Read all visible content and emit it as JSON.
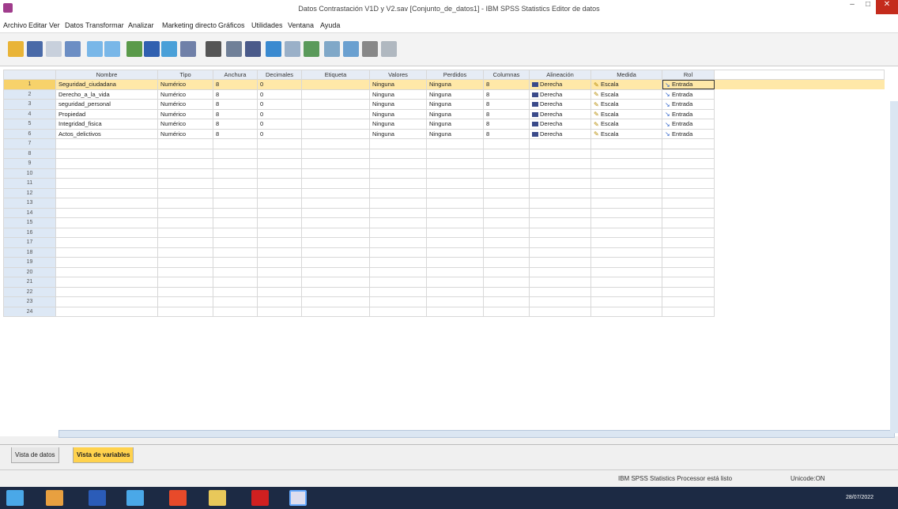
{
  "window": {
    "title": "Datos Contrastación V1D y V2.sav [Conjunto_de_datos1] - IBM SPSS Statistics Editor de datos"
  },
  "menu": [
    "Archivo",
    "Editar",
    "Ver",
    "Datos",
    "Transformar",
    "Analizar",
    "Marketing directo",
    "Gráficos",
    "Utilidades",
    "Ventana",
    "Ayuda"
  ],
  "columns": [
    "Nombre",
    "Tipo",
    "Anchura",
    "Decimales",
    "Etiqueta",
    "Valores",
    "Perdidos",
    "Columnas",
    "Alineación",
    "Medida",
    "Rol"
  ],
  "variables": [
    {
      "n": "1",
      "name": "Seguridad_ciudadana",
      "type": "Numérico",
      "width": "8",
      "dec": "0",
      "label": "",
      "values": "Ninguna",
      "missing": "Ninguna",
      "cols": "8",
      "align": "Derecha",
      "measure": "Escala",
      "role": "Entrada"
    },
    {
      "n": "2",
      "name": "Derecho_a_la_vida",
      "type": "Numérico",
      "width": "8",
      "dec": "0",
      "label": "",
      "values": "Ninguna",
      "missing": "Ninguna",
      "cols": "8",
      "align": "Derecha",
      "measure": "Escala",
      "role": "Entrada"
    },
    {
      "n": "3",
      "name": "seguridad_personal",
      "type": "Numérico",
      "width": "8",
      "dec": "0",
      "label": "",
      "values": "Ninguna",
      "missing": "Ninguna",
      "cols": "8",
      "align": "Derecha",
      "measure": "Escala",
      "role": "Entrada"
    },
    {
      "n": "4",
      "name": "Propiedad",
      "type": "Numérico",
      "width": "8",
      "dec": "0",
      "label": "",
      "values": "Ninguna",
      "missing": "Ninguna",
      "cols": "8",
      "align": "Derecha",
      "measure": "Escala",
      "role": "Entrada"
    },
    {
      "n": "5",
      "name": "Integridad_fisica",
      "type": "Numérico",
      "width": "8",
      "dec": "0",
      "label": "",
      "values": "Ninguna",
      "missing": "Ninguna",
      "cols": "8",
      "align": "Derecha",
      "measure": "Escala",
      "role": "Entrada"
    },
    {
      "n": "6",
      "name": "Actos_delictivos",
      "type": "Numérico",
      "width": "8",
      "dec": "0",
      "label": "",
      "values": "Ninguna",
      "missing": "Ninguna",
      "cols": "8",
      "align": "Derecha",
      "measure": "Escala",
      "role": "Entrada"
    }
  ],
  "empty_rows": [
    "7",
    "8",
    "9",
    "10",
    "11",
    "12",
    "13",
    "14",
    "15",
    "16",
    "17",
    "18",
    "19",
    "20",
    "21",
    "22",
    "23",
    "24"
  ],
  "tabs": {
    "data_view": "Vista de datos",
    "variable_view": "Vista de variables"
  },
  "status": {
    "processor": "IBM SPSS Statistics Processor está listo",
    "unicode": "Unicode:ON"
  },
  "taskbar": {
    "date": "28/07/2022"
  },
  "colors": {
    "selected_row": "#ffe8a8",
    "header": "#e6ecf5",
    "active_tab": "#ffd24d",
    "taskbar": "#1c2a44"
  }
}
